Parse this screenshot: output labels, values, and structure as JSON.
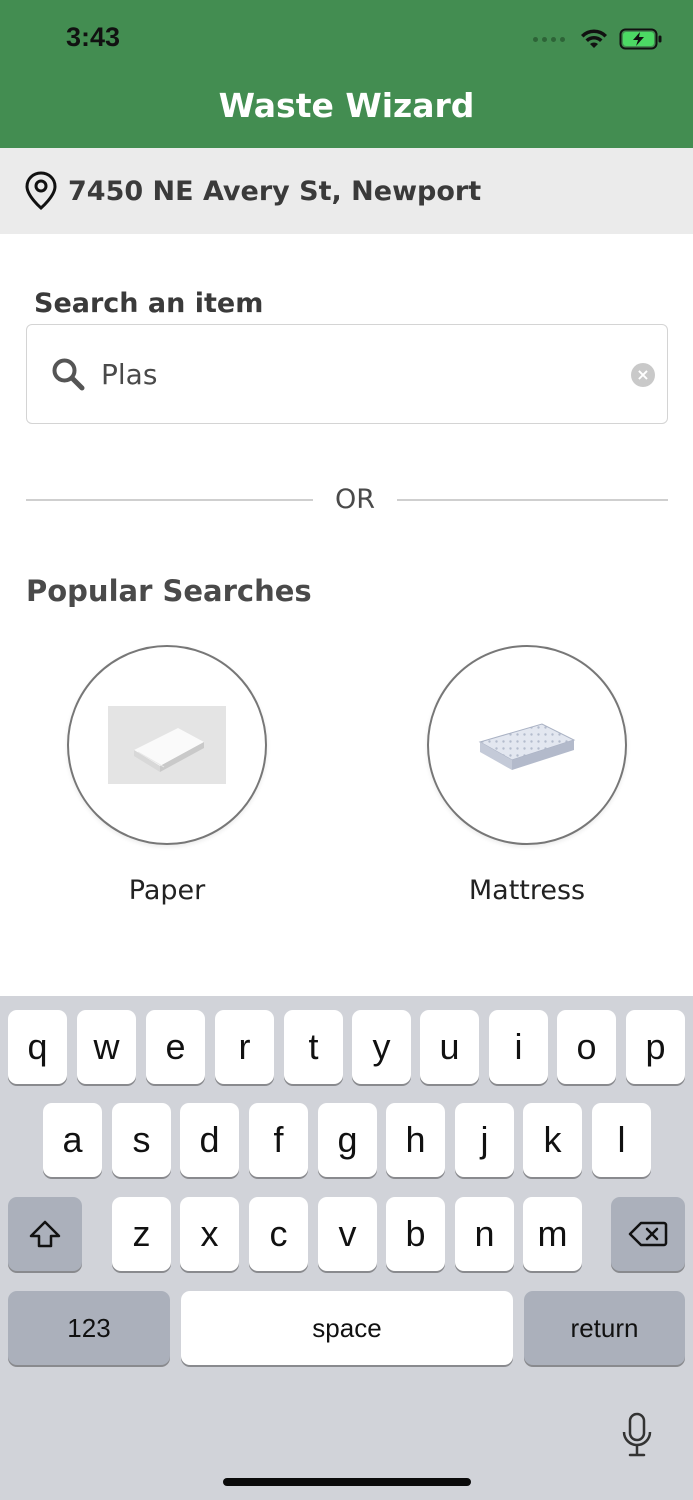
{
  "status_bar": {
    "time": "3:43"
  },
  "header": {
    "title": "Waste Wizard"
  },
  "address": {
    "text": "7450 NE Avery St, Newport"
  },
  "search": {
    "label": "Search an item",
    "value": "Plas",
    "clear_symbol": "×"
  },
  "divider": {
    "or_text": "OR"
  },
  "popular": {
    "title": "Popular Searches",
    "items": [
      {
        "label": "Paper"
      },
      {
        "label": "Mattress"
      }
    ]
  },
  "keyboard": {
    "row1": [
      "q",
      "w",
      "e",
      "r",
      "t",
      "y",
      "u",
      "i",
      "o",
      "p"
    ],
    "row2": [
      "a",
      "s",
      "d",
      "f",
      "g",
      "h",
      "j",
      "k",
      "l"
    ],
    "row3": [
      "z",
      "x",
      "c",
      "v",
      "b",
      "n",
      "m"
    ],
    "numbers_label": "123",
    "space_label": "space",
    "return_label": "return"
  },
  "colors": {
    "header_green": "#438d51",
    "address_bg": "#ebebeb",
    "keyboard_bg": "#d1d3d9"
  }
}
